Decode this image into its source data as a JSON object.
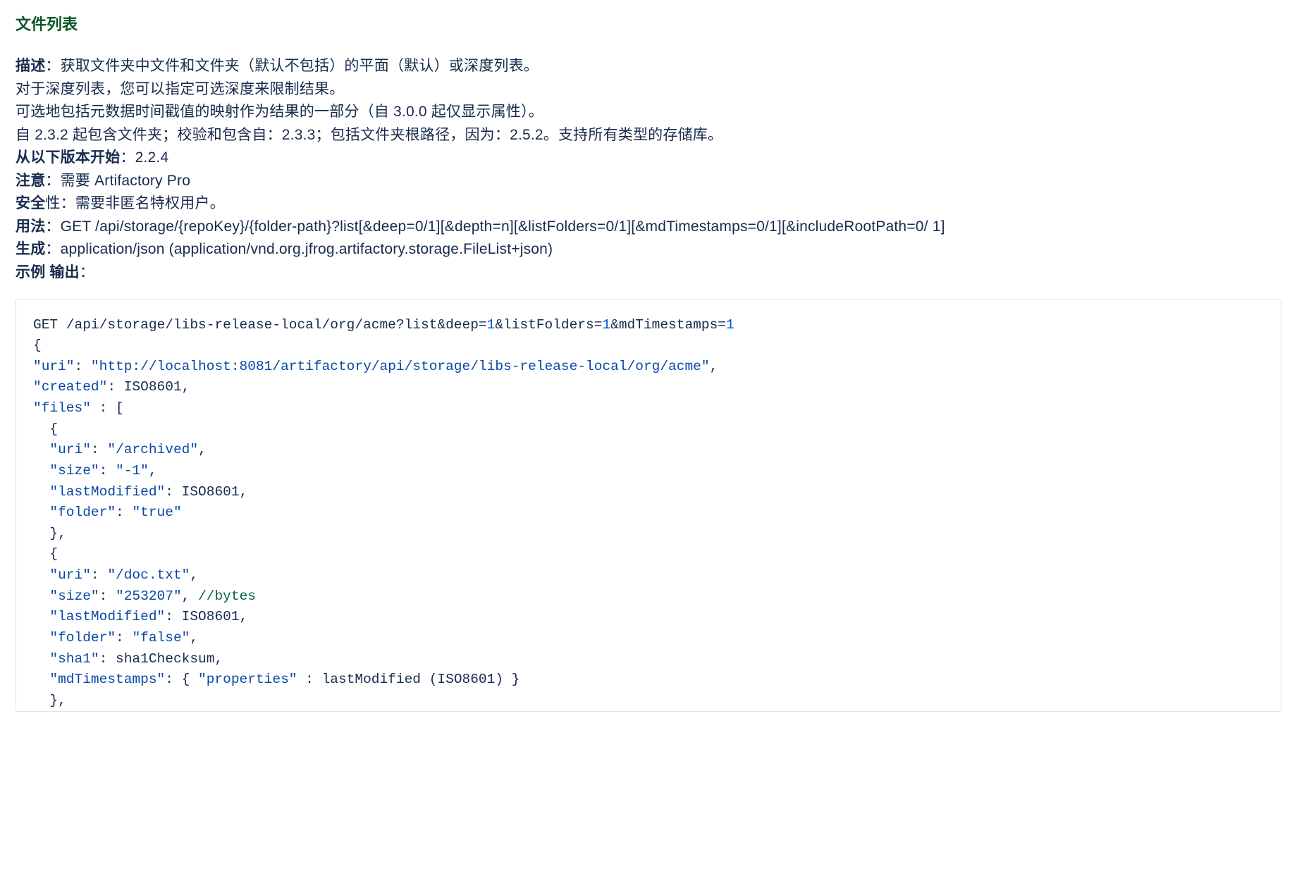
{
  "title": "文件列表",
  "desc": {
    "l1_label": "描述",
    "l1_sep": "：",
    "l1_b": "获取文件夹中文件和文件夹（默认不包括）的平面（默认）或深度列表。",
    "l2": "对于深度列表，您可以指定可选深度来限制结果。",
    "l3": "可选地包括元数据时间戳值的映射作为结果的一部分（自 3.0.0 起仅显示属性）。",
    "l4": "自 2.3.2 起包含文件夹；校验和包含自：2.3.3；包括文件夹根路径，因为：2.5.2。支持所有类型的存储库。",
    "l5_label": "从以下版本开始",
    "l5_val": "：2.2.4",
    "l6_label": "注意",
    "l6_val": "：需要 Artifactory Pro",
    "l7_label": "安全",
    "l7_mid": "性：",
    "l7_val": "需要非匿名特权用户。",
    "l8_label": "用法",
    "l8_val": "：GET /api/storage/{repoKey}/{folder-path}?list[&deep=0/1][&depth=n][&listFolders=0/1][&mdTimestamps=0/1][&includeRootPath=0/ 1]",
    "l9_label": "生成",
    "l9_val": "：application/json (application/vnd.org.jfrog.artifactory.storage.FileList+json)",
    "l10_label": "示例 输出",
    "l10_val": "："
  },
  "code": {
    "line01_a": "GET /api/storage/libs-release-local/org/acme?list&deep=",
    "line01_n1": "1",
    "line01_b": "&listFolders=",
    "line01_n2": "1",
    "line01_c": "&mdTimestamps=",
    "line01_n3": "1",
    "line02": "{",
    "line03_a": "\"uri\"",
    "line03_b": ": ",
    "line03_c": "\"http://localhost:8081/artifactory/api/storage/libs-release-local/org/acme\"",
    "line03_d": ",",
    "line04_a": "\"created\"",
    "line04_b": ": ISO8601,",
    "line05_a": "\"files\"",
    "line05_b": " : [",
    "line06": "  {",
    "line07_a": "  \"uri\"",
    "line07_b": ": ",
    "line07_c": "\"/archived\"",
    "line07_d": ",",
    "line08_a": "  \"size\"",
    "line08_b": ": ",
    "line08_c": "\"-1\"",
    "line08_d": ",",
    "line09_a": "  \"lastModified\"",
    "line09_b": ": ISO8601,",
    "line10_a": "  \"folder\"",
    "line10_b": ": ",
    "line10_c": "\"true\"",
    "line11": "  },",
    "line12": "  {",
    "line13_a": "  \"uri\"",
    "line13_b": ": ",
    "line13_c": "\"/doc.txt\"",
    "line13_d": ",",
    "line14_a": "  \"size\"",
    "line14_b": ": ",
    "line14_c": "\"253207\"",
    "line14_d": ", ",
    "line14_cmt": "//bytes",
    "line15_a": "  \"lastModified\"",
    "line15_b": ": ISO8601,",
    "line16_a": "  \"folder\"",
    "line16_b": ": ",
    "line16_c": "\"false\"",
    "line16_d": ",",
    "line17_a": "  \"sha1\"",
    "line17_b": ": sha1Checksum,",
    "line18_a": "  \"mdTimestamps\"",
    "line18_b": ": { ",
    "line18_c": "\"properties\"",
    "line18_d": " : lastModified (ISO8601) }",
    "line19": "  },"
  }
}
